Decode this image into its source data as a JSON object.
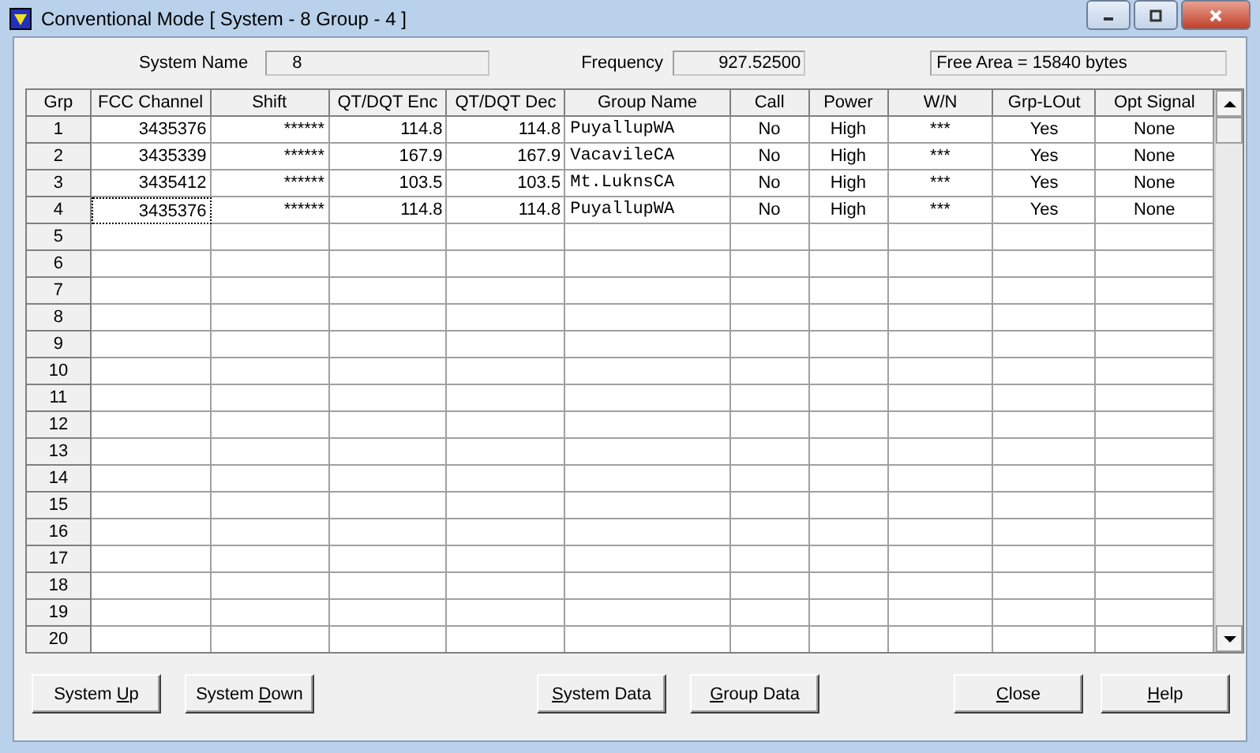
{
  "window": {
    "title": "Conventional Mode [ System - 8  Group - 4 ]"
  },
  "fields": [
    {
      "label": "System Name",
      "value": "8"
    },
    {
      "label": "Frequency",
      "value": "927.52500"
    }
  ],
  "free_area": "Free Area = 15840 bytes",
  "table": {
    "columns": [
      "Grp",
      "FCC Channel",
      "Shift",
      "QT/DQT Enc",
      "QT/DQT Dec",
      "Group Name",
      "Call",
      "Power",
      "W/N",
      "Grp-LOut",
      "Opt Signal"
    ],
    "rows": [
      {
        "cells": [
          "1",
          "3435376",
          "******",
          "114.8",
          "114.8",
          "PuyallupWA",
          "No",
          "High",
          "***",
          "Yes",
          "None"
        ],
        "focused": false
      },
      {
        "cells": [
          "2",
          "3435339",
          "******",
          "167.9",
          "167.9",
          "VacavileCA",
          "No",
          "High",
          "***",
          "Yes",
          "None"
        ],
        "focused": false
      },
      {
        "cells": [
          "3",
          "3435412",
          "******",
          "103.5",
          "103.5",
          "Mt.LuknsCA",
          "No",
          "High",
          "***",
          "Yes",
          "None"
        ],
        "focused": false
      },
      {
        "cells": [
          "4",
          "3435376",
          "******",
          "114.8",
          "114.8",
          "PuyallupWA",
          "No",
          "High",
          "***",
          "Yes",
          "None"
        ],
        "focused": true
      },
      {
        "cells": [
          "5"
        ],
        "focused": false
      },
      {
        "cells": [
          "6"
        ],
        "focused": false
      },
      {
        "cells": [
          "7"
        ],
        "focused": false
      },
      {
        "cells": [
          "8"
        ],
        "focused": false
      },
      {
        "cells": [
          "9"
        ],
        "focused": false
      },
      {
        "cells": [
          "10"
        ],
        "focused": false
      },
      {
        "cells": [
          "11"
        ],
        "focused": false
      },
      {
        "cells": [
          "12"
        ],
        "focused": false
      },
      {
        "cells": [
          "13"
        ],
        "focused": false
      },
      {
        "cells": [
          "14"
        ],
        "focused": false
      },
      {
        "cells": [
          "15"
        ],
        "focused": false
      },
      {
        "cells": [
          "16"
        ],
        "focused": false
      },
      {
        "cells": [
          "17"
        ],
        "focused": false
      },
      {
        "cells": [
          "18"
        ],
        "focused": false
      },
      {
        "cells": [
          "19"
        ],
        "focused": false
      },
      {
        "cells": [
          "20"
        ],
        "focused": false
      }
    ]
  },
  "buttons": [
    {
      "before": "System ",
      "key": "U",
      "after": "p"
    },
    {
      "before": "System ",
      "key": "D",
      "after": "own"
    },
    {
      "key": "S",
      "after": "ystem Data"
    },
    {
      "key": "G",
      "after": "roup Data"
    },
    {
      "key": "C",
      "after": "lose"
    },
    {
      "key": "H",
      "after": "elp"
    }
  ]
}
